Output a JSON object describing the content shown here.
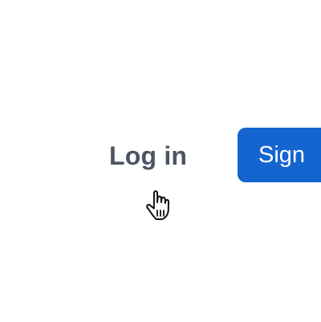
{
  "auth": {
    "login_label": "Log in",
    "signup_label": "Sign"
  },
  "colors": {
    "login_text": "#4b5563",
    "signup_bg": "#1565d0",
    "signup_text": "#ffffff"
  },
  "cursor": {
    "icon": "pointer-hand-icon"
  }
}
